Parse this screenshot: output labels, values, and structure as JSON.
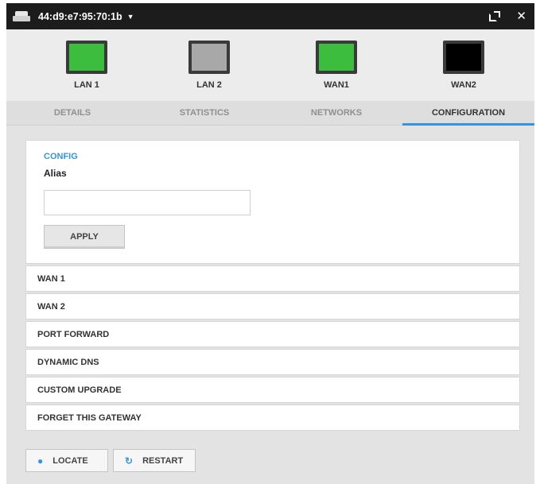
{
  "titlebar": {
    "device_mac": "44:d9:e7:95:70:1b",
    "caret": "▼",
    "close_glyph": "✕"
  },
  "ports": [
    {
      "label": "LAN 1",
      "status_color": "#3dbd3d"
    },
    {
      "label": "LAN 2",
      "status_color": "#a8a8a8"
    },
    {
      "label": "WAN1",
      "status_color": "#3dbd3d"
    },
    {
      "label": "WAN2",
      "status_color": "#000000"
    }
  ],
  "tabs": [
    {
      "label": "DETAILS",
      "active": false
    },
    {
      "label": "STATISTICS",
      "active": false
    },
    {
      "label": "NETWORKS",
      "active": false
    },
    {
      "label": "CONFIGURATION",
      "active": true
    }
  ],
  "config": {
    "section_title": "CONFIG",
    "alias_label": "Alias",
    "alias_value": "",
    "apply_label": "APPLY"
  },
  "sections": [
    {
      "label": "WAN 1"
    },
    {
      "label": "WAN 2"
    },
    {
      "label": "PORT FORWARD"
    },
    {
      "label": "DYNAMIC DNS"
    },
    {
      "label": "CUSTOM UPGRADE"
    },
    {
      "label": "FORGET THIS GATEWAY"
    }
  ],
  "actions": {
    "locate_label": "LOCATE",
    "locate_icon": "location-pin-icon",
    "restart_label": "RESTART",
    "restart_icon": "restart-icon"
  },
  "colors": {
    "accent": "#3a93d8",
    "titlebar_bg": "#1c1c1c"
  }
}
